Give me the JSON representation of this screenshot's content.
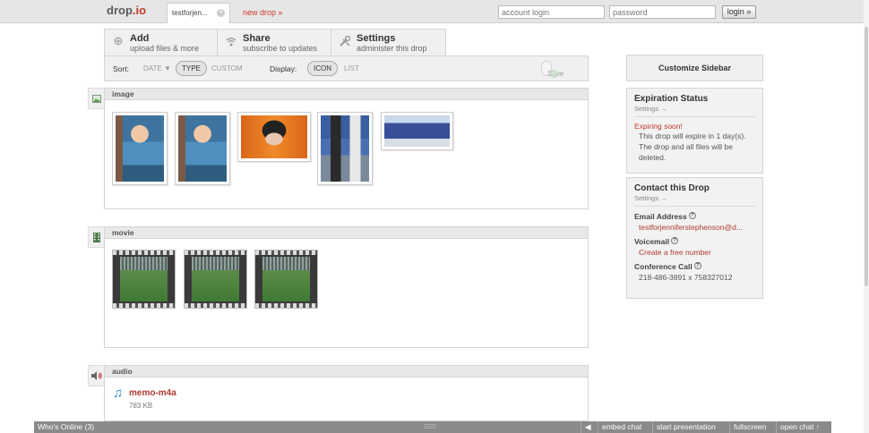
{
  "topbar": {
    "logo_text": "drop",
    "logo_suffix": ".io",
    "drop_tab": "testforjen...",
    "new_drop": "new drop »",
    "account_placeholder": "account login",
    "password_placeholder": "password",
    "login_label": "login »"
  },
  "actions": [
    {
      "title": "Add",
      "subtitle": "upload files & more"
    },
    {
      "title": "Share",
      "subtitle": "subscribe to updates"
    },
    {
      "title": "Settings",
      "subtitle": "administer this drop"
    }
  ],
  "sortbar": {
    "sort_label": "Sort:",
    "date": "DATE ▼",
    "type": "TYPE",
    "custom": "CUSTOM",
    "display_label": "Display:",
    "icon": "ICON",
    "list": "LIST",
    "save": "Save"
  },
  "sections": {
    "image": "image",
    "movie": "movie",
    "audio": "audio"
  },
  "audio_item": {
    "name": "memo-m4a",
    "size": "783 KB"
  },
  "sidebar": {
    "customize": "Customize Sidebar",
    "expiration": {
      "title": "Expiration Status",
      "settings": "Settings →",
      "warning": "Expiring soon!",
      "text": "This drop will expire in 1 day(s). The drop and all files will be deleted."
    },
    "contact": {
      "title": "Contact this Drop",
      "settings": "Settings →",
      "email_label": "Email Address",
      "email_value": "testforjenniferstephenson@d...",
      "voicemail_label": "Voicemail",
      "voicemail_value": "Create a free number",
      "conf_label": "Conference Call",
      "conf_value": "218-486-3891 x 758327012"
    }
  },
  "bottombar": {
    "whos_online": "Who's Online (3)",
    "embed_chat": "embed chat",
    "start_presentation": "start presentation",
    "fullscreen": "fullscreen",
    "open_chat": "open chat ↑"
  },
  "icons": [
    "add-icon",
    "share-icon",
    "settings-icon",
    "image-section-icon",
    "movie-section-icon",
    "audio-section-icon",
    "music-note-icon",
    "help-icon",
    "speaker-icon"
  ]
}
